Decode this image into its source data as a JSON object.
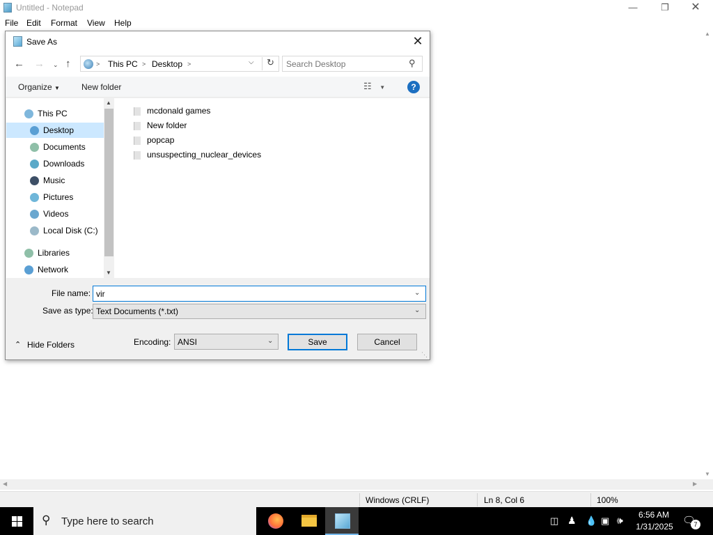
{
  "notepad": {
    "title": "Untitled - Notepad",
    "menu": [
      "File",
      "Edit",
      "Format",
      "View",
      "Help"
    ],
    "status": {
      "line_ending": "Windows (CRLF)",
      "position": "Ln 8, Col 6",
      "zoom": "100%"
    }
  },
  "dialog": {
    "title": "Save As",
    "address": {
      "segments": [
        "This PC",
        "Desktop"
      ]
    },
    "search_placeholder": "Search Desktop",
    "commands": {
      "organize": "Organize",
      "new_folder": "New folder"
    },
    "tree": [
      {
        "label": "This PC",
        "icon": "computer-icon"
      },
      {
        "label": "Desktop",
        "icon": "desktop-icon",
        "selected": true
      },
      {
        "label": "Documents",
        "icon": "documents-icon"
      },
      {
        "label": "Downloads",
        "icon": "downloads-icon"
      },
      {
        "label": "Music",
        "icon": "music-icon"
      },
      {
        "label": "Pictures",
        "icon": "pictures-icon"
      },
      {
        "label": "Videos",
        "icon": "videos-icon"
      },
      {
        "label": "Local Disk (C:)",
        "icon": "disk-icon"
      },
      {
        "label": "Libraries",
        "icon": "libraries-icon"
      },
      {
        "label": "Network",
        "icon": "network-icon"
      }
    ],
    "files": [
      {
        "name": "mcdonald games"
      },
      {
        "name": "New folder"
      },
      {
        "name": "popcap"
      },
      {
        "name": "unsuspecting_nuclear_devices"
      }
    ],
    "file_name_label": "File name:",
    "file_name_value": "vir",
    "save_type_label": "Save as type:",
    "save_type_value": "Text Documents (*.txt)",
    "hide_folders": "Hide Folders",
    "encoding_label": "Encoding:",
    "encoding_value": "ANSI",
    "save": "Save",
    "cancel": "Cancel"
  },
  "taskbar": {
    "search_placeholder": "Type here to search",
    "time": "6:56 AM",
    "date": "1/31/2025",
    "notifications": "7",
    "apps": [
      "firefox-icon",
      "file-explorer-icon",
      "notepad-icon"
    ]
  },
  "colors": {
    "accent": "#0078d7",
    "selection": "#cce8ff",
    "help": "#1c6fc1"
  }
}
